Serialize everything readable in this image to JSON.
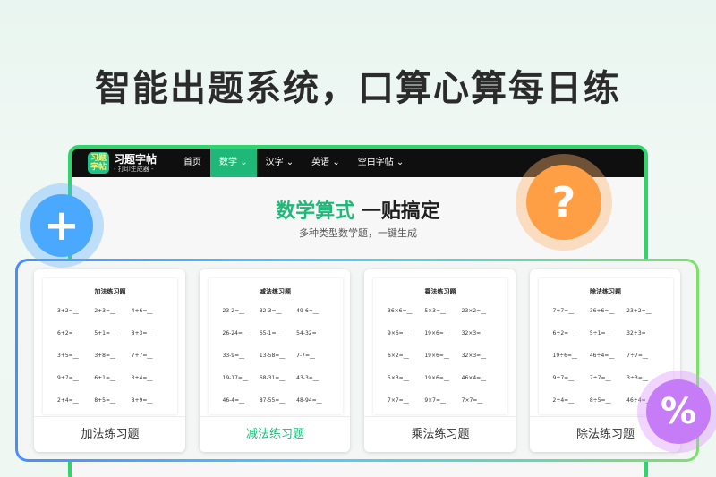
{
  "headline": "智能出题系统，口算心算每日练",
  "nav": {
    "logo_name": "习题字帖",
    "logo_sub": "- 打印生成器 -",
    "logo_badge_top": "习题",
    "logo_badge_bottom": "字帖",
    "items": [
      {
        "label": "首页"
      },
      {
        "label": "数学"
      },
      {
        "label": "汉字"
      },
      {
        "label": "英语"
      },
      {
        "label": "空白字帖"
      }
    ]
  },
  "hero": {
    "title_green": "数学算式",
    "title_dark": "一贴搞定",
    "subtitle": "多种类型数学题，一键生成"
  },
  "cards": [
    {
      "sheet_title": "加法练习题",
      "label": "加法练习题",
      "problems": [
        "3+2=__",
        "2+3=__",
        "4+6=__",
        "6+2=__",
        "5+1=__",
        "8+3=__",
        "3+5=__",
        "3+8=__",
        "7+7=__",
        "9+7=__",
        "6+1=__",
        "3+4=__",
        "2+4=__",
        "8+5=__",
        "8+9=__"
      ]
    },
    {
      "sheet_title": "减法练习题",
      "label": "减法练习题",
      "problems": [
        "23-2=__",
        "32-3=__",
        "49-6=__",
        "26-24=__",
        "65-1=__",
        "54-32=__",
        "33-9=__",
        "13-58=__",
        "7-7=__",
        "19-17=__",
        "68-31=__",
        "43-3=__",
        "46-4=__",
        "87-55=__",
        "48-94=__"
      ]
    },
    {
      "sheet_title": "乘法练习题",
      "label": "乘法练习题",
      "problems": [
        "36×6=__",
        "5×3=__",
        "23×2=__",
        "9×6=__",
        "19×6=__",
        "32×3=__",
        "6×2=__",
        "19×6=__",
        "32×3=__",
        "5×3=__",
        "19×6=__",
        "46×4=__",
        "7×7=__",
        "9×7=__",
        "7×7=__"
      ]
    },
    {
      "sheet_title": "除法练习题",
      "label": "除法练习题",
      "problems": [
        "7÷7=__",
        "36÷6=__",
        "23÷2=__",
        "6÷2=__",
        "5÷1=__",
        "32÷3=__",
        "19÷6=__",
        "46÷4=__",
        "7÷7=__",
        "9÷7=__",
        "7÷7=__",
        "3÷3=__",
        "2÷4=__",
        "8÷5=__",
        "46÷4=__"
      ]
    }
  ],
  "decor": {
    "plus_symbol": "+",
    "question_symbol": "?",
    "divide_symbol": "%"
  },
  "colors": {
    "accent_green": "#1fb878",
    "frame_green": "#2fd46a",
    "plus_blue": "#4aa9ff",
    "question_orange": "#ff9f45",
    "divide_purple": "#c67bf7"
  }
}
